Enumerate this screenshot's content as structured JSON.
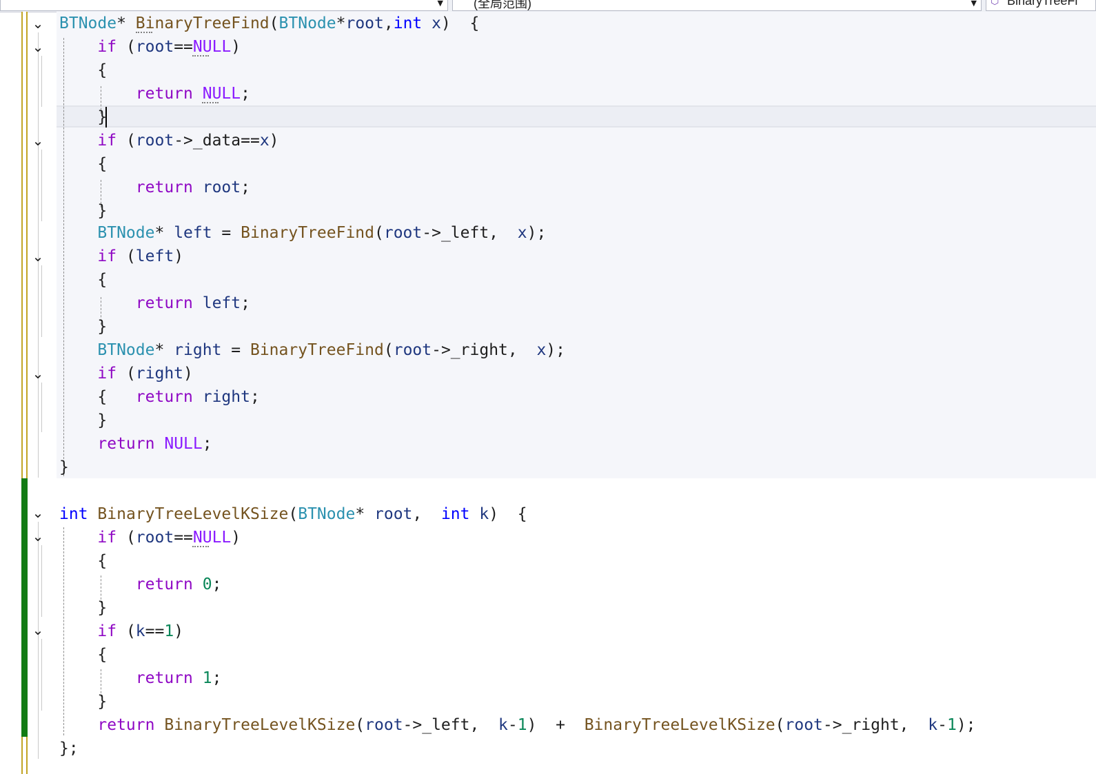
{
  "navbar": {
    "scope_label": "(全局范围)",
    "member_label": "BinaryTreeFi",
    "member_icon": "cube-icon",
    "dropdown_icon": "chevron-down-icon"
  },
  "colors": {
    "keyword": "#8f08c4",
    "type_keyword": "#0000ff",
    "class_name": "#2b91af",
    "function_name": "#74531f",
    "parameter": "#1f377f",
    "macro": "#8a1bff",
    "changed_saved_bar": "#c2a424",
    "changed_unsaved_bar": "#127b14"
  },
  "code": {
    "lines": [
      [
        {
          "t": "BTNode",
          "c": "cl"
        },
        {
          "t": "* "
        },
        {
          "t": "BinaryTreeFind",
          "c": "fn"
        },
        {
          "t": "("
        },
        {
          "t": "BTNode",
          "c": "cl"
        },
        {
          "t": "*"
        },
        {
          "t": "root",
          "c": "pr"
        },
        {
          "t": ","
        },
        {
          "t": "int",
          "c": "ty"
        },
        {
          "t": " "
        },
        {
          "t": "x",
          "c": "pr"
        },
        {
          "t": ")  {"
        }
      ],
      [
        {
          "t": "    "
        },
        {
          "t": "if",
          "c": "kw"
        },
        {
          "t": " ("
        },
        {
          "t": "root",
          "c": "pr"
        },
        {
          "t": "=="
        },
        {
          "t": "NULL",
          "c": "mc"
        },
        {
          "t": ")"
        }
      ],
      [
        {
          "t": "    {"
        }
      ],
      [
        {
          "t": "        "
        },
        {
          "t": "return",
          "c": "kw"
        },
        {
          "t": " "
        },
        {
          "t": "NULL",
          "c": "mc"
        },
        {
          "t": ";"
        }
      ],
      [
        {
          "t": "    }"
        }
      ],
      [
        {
          "t": "    "
        },
        {
          "t": "if",
          "c": "kw"
        },
        {
          "t": " ("
        },
        {
          "t": "root",
          "c": "pr"
        },
        {
          "t": "->_data=="
        },
        {
          "t": "x",
          "c": "pr"
        },
        {
          "t": ")"
        }
      ],
      [
        {
          "t": "    {"
        }
      ],
      [
        {
          "t": "        "
        },
        {
          "t": "return",
          "c": "kw"
        },
        {
          "t": " "
        },
        {
          "t": "root",
          "c": "pr"
        },
        {
          "t": ";"
        }
      ],
      [
        {
          "t": "    }"
        }
      ],
      [
        {
          "t": "    "
        },
        {
          "t": "BTNode",
          "c": "cl"
        },
        {
          "t": "* "
        },
        {
          "t": "left",
          "c": "lo"
        },
        {
          "t": " = "
        },
        {
          "t": "BinaryTreeFind",
          "c": "fn"
        },
        {
          "t": "("
        },
        {
          "t": "root",
          "c": "pr"
        },
        {
          "t": "->_left,  "
        },
        {
          "t": "x",
          "c": "pr"
        },
        {
          "t": ");"
        }
      ],
      [
        {
          "t": "    "
        },
        {
          "t": "if",
          "c": "kw"
        },
        {
          "t": " ("
        },
        {
          "t": "left",
          "c": "lo"
        },
        {
          "t": ")"
        }
      ],
      [
        {
          "t": "    {"
        }
      ],
      [
        {
          "t": "        "
        },
        {
          "t": "return",
          "c": "kw"
        },
        {
          "t": " "
        },
        {
          "t": "left",
          "c": "lo"
        },
        {
          "t": ";"
        }
      ],
      [
        {
          "t": "    }"
        }
      ],
      [
        {
          "t": "    "
        },
        {
          "t": "BTNode",
          "c": "cl"
        },
        {
          "t": "* "
        },
        {
          "t": "right",
          "c": "lo"
        },
        {
          "t": " = "
        },
        {
          "t": "BinaryTreeFind",
          "c": "fn"
        },
        {
          "t": "("
        },
        {
          "t": "root",
          "c": "pr"
        },
        {
          "t": "->_right,  "
        },
        {
          "t": "x",
          "c": "pr"
        },
        {
          "t": ");"
        }
      ],
      [
        {
          "t": "    "
        },
        {
          "t": "if",
          "c": "kw"
        },
        {
          "t": " ("
        },
        {
          "t": "right",
          "c": "lo"
        },
        {
          "t": ")"
        }
      ],
      [
        {
          "t": "    {   "
        },
        {
          "t": "return",
          "c": "kw"
        },
        {
          "t": " "
        },
        {
          "t": "right",
          "c": "lo"
        },
        {
          "t": ";"
        }
      ],
      [
        {
          "t": "    }"
        }
      ],
      [
        {
          "t": "    "
        },
        {
          "t": "return",
          "c": "kw"
        },
        {
          "t": " "
        },
        {
          "t": "NULL",
          "c": "mc"
        },
        {
          "t": ";"
        }
      ],
      [
        {
          "t": "}"
        }
      ],
      [],
      [
        {
          "t": "int",
          "c": "ty"
        },
        {
          "t": " "
        },
        {
          "t": "BinaryTreeLevelKSize",
          "c": "fn"
        },
        {
          "t": "("
        },
        {
          "t": "BTNode",
          "c": "cl"
        },
        {
          "t": "* "
        },
        {
          "t": "root",
          "c": "pr"
        },
        {
          "t": ",  "
        },
        {
          "t": "int",
          "c": "ty"
        },
        {
          "t": " "
        },
        {
          "t": "k",
          "c": "pr"
        },
        {
          "t": ")  {"
        }
      ],
      [
        {
          "t": "    "
        },
        {
          "t": "if",
          "c": "kw"
        },
        {
          "t": " ("
        },
        {
          "t": "root",
          "c": "pr"
        },
        {
          "t": "=="
        },
        {
          "t": "NULL",
          "c": "mc"
        },
        {
          "t": ")"
        }
      ],
      [
        {
          "t": "    {"
        }
      ],
      [
        {
          "t": "        "
        },
        {
          "t": "return",
          "c": "kw"
        },
        {
          "t": " "
        },
        {
          "t": "0",
          "c": "nu"
        },
        {
          "t": ";"
        }
      ],
      [
        {
          "t": "    }"
        }
      ],
      [
        {
          "t": "    "
        },
        {
          "t": "if",
          "c": "kw"
        },
        {
          "t": " ("
        },
        {
          "t": "k",
          "c": "pr"
        },
        {
          "t": "=="
        },
        {
          "t": "1",
          "c": "nu"
        },
        {
          "t": ")"
        }
      ],
      [
        {
          "t": "    {"
        }
      ],
      [
        {
          "t": "        "
        },
        {
          "t": "return",
          "c": "kw"
        },
        {
          "t": " "
        },
        {
          "t": "1",
          "c": "nu"
        },
        {
          "t": ";"
        }
      ],
      [
        {
          "t": "    }"
        }
      ],
      [
        {
          "t": "    "
        },
        {
          "t": "return",
          "c": "kw"
        },
        {
          "t": " "
        },
        {
          "t": "BinaryTreeLevelKSize",
          "c": "fn"
        },
        {
          "t": "("
        },
        {
          "t": "root",
          "c": "pr"
        },
        {
          "t": "->_left,  "
        },
        {
          "t": "k",
          "c": "pr"
        },
        {
          "t": "-"
        },
        {
          "t": "1",
          "c": "nu"
        },
        {
          "t": ")  +  "
        },
        {
          "t": "BinaryTreeLevelKSize",
          "c": "fn"
        },
        {
          "t": "("
        },
        {
          "t": "root",
          "c": "pr"
        },
        {
          "t": "->_right,  "
        },
        {
          "t": "k",
          "c": "pr"
        },
        {
          "t": "-"
        },
        {
          "t": "1",
          "c": "nu"
        },
        {
          "t": ");"
        }
      ],
      [
        {
          "t": "};"
        }
      ]
    ]
  }
}
